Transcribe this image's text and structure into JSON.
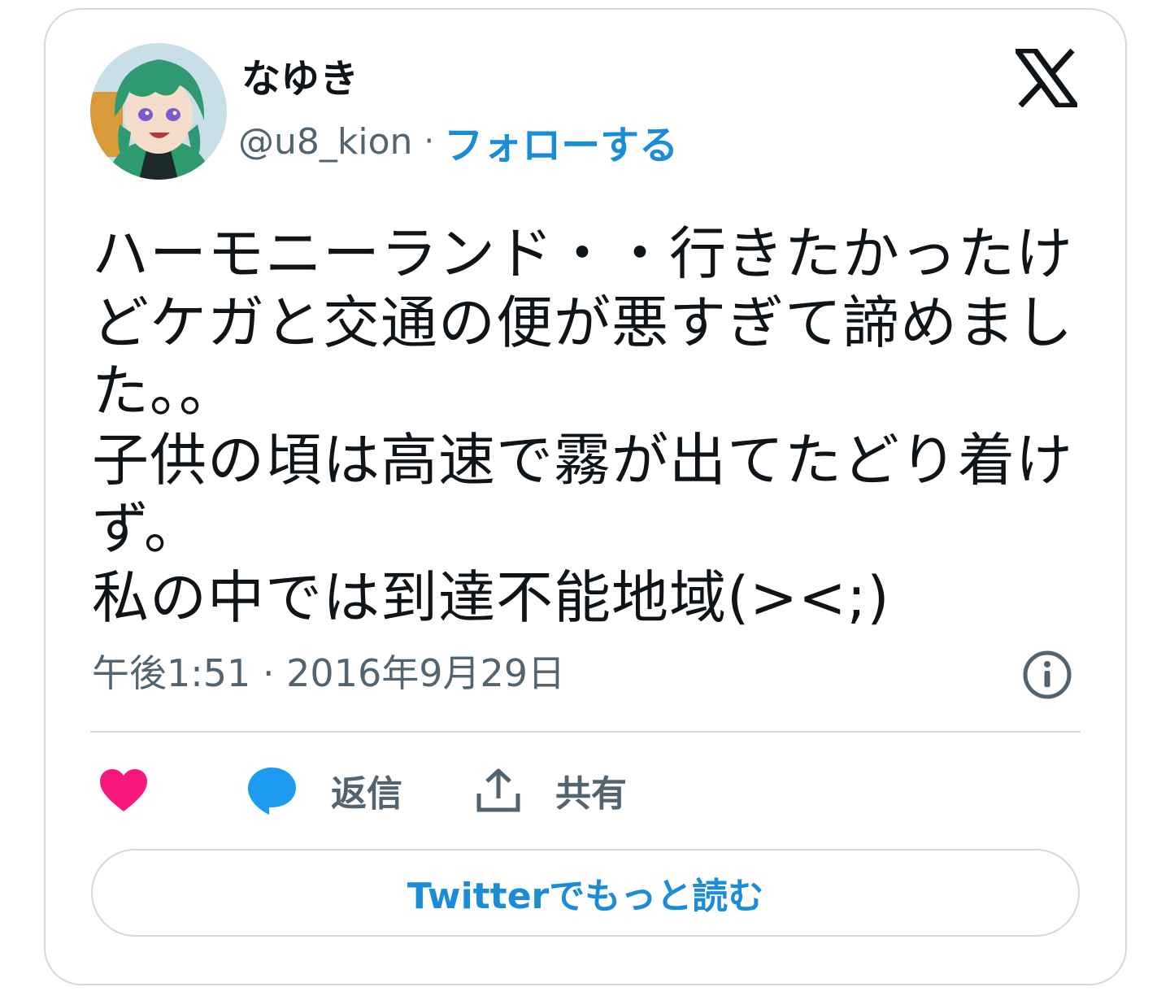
{
  "author": {
    "display_name": "なゆき",
    "handle": "@u8_kion",
    "separator": "·",
    "follow_label": "フォローする",
    "avatar": "anime-character-avatar"
  },
  "brand": {
    "logo": "x-logo-icon",
    "color": "#0f1419"
  },
  "tweet": {
    "lines": [
      "ハーモニーランド・・行きたかったけ",
      "どケガと交通の便が悪すぎて諦めまし",
      "た。。",
      "子供の頃は高速で霧が出てたどり着け",
      "ず。",
      "私の中では到達不能地域(><;)"
    ],
    "timestamp": "午後1:51 · 2016年9月29日"
  },
  "actions": {
    "like": {
      "icon": "heart-icon",
      "color": "#f91880"
    },
    "reply": {
      "icon": "speech-bubble-icon",
      "label": "返信",
      "color": "#1d9bf0"
    },
    "share": {
      "icon": "upload-share-icon",
      "label": "共有"
    }
  },
  "read_more_label": "Twitterでもっと読む",
  "colors": {
    "accent": "#1a8cd8",
    "secondary_text": "#536471",
    "border": "#cfd9de"
  }
}
